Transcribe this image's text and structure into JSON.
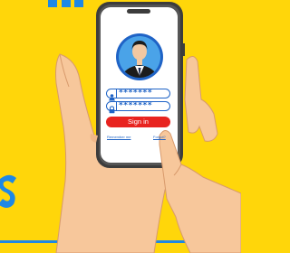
{
  "login": {
    "username_value": "*******",
    "password_value": "*******",
    "signin_label": "Sign in",
    "remember_label": "Remember me",
    "forgot_label": "Forgot?"
  },
  "colors": {
    "background": "#ffd60a",
    "accent_blue": "#1f63c6",
    "button_red": "#e8231f",
    "phone_body": "#3c3c3c",
    "avatar_bg": "#2b7fd6"
  },
  "icons": [
    "user-icon",
    "lock-icon",
    "avatar"
  ]
}
